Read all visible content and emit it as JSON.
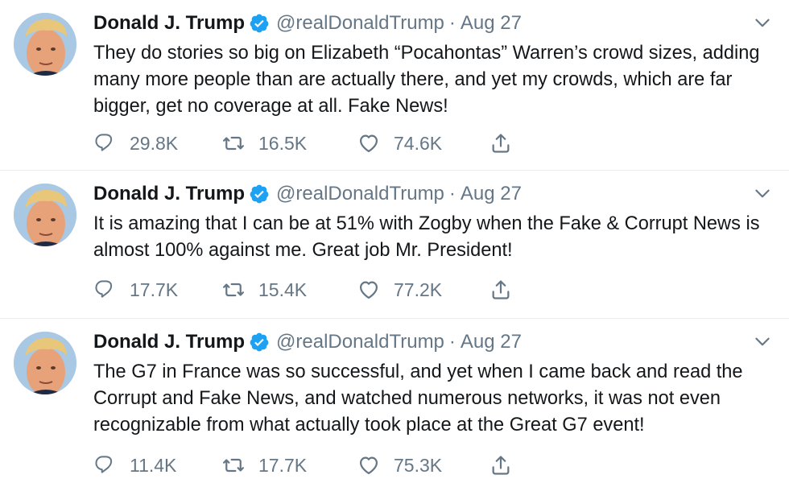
{
  "tweets": [
    {
      "author": {
        "name": "Donald J. Trump",
        "handle": "@realDonaldTrump",
        "verified": true
      },
      "separator": "·",
      "date": "Aug 27",
      "text": "They do stories so big on Elizabeth “Pocahontas” Warren’s crowd sizes, adding many more people than are actually there, and yet my crowds, which are far bigger, get no coverage at all. Fake News!",
      "replies": "29.8K",
      "retweets": "16.5K",
      "likes": "74.6K"
    },
    {
      "author": {
        "name": "Donald J. Trump",
        "handle": "@realDonaldTrump",
        "verified": true
      },
      "separator": "·",
      "date": "Aug 27",
      "text": "It is amazing that I can be at 51% with Zogby when the Fake & Corrupt News is almost 100% against me. Great job Mr. President!",
      "replies": "17.7K",
      "retweets": "15.4K",
      "likes": "77.2K"
    },
    {
      "author": {
        "name": "Donald J. Trump",
        "handle": "@realDonaldTrump",
        "verified": true
      },
      "separator": "·",
      "date": "Aug 27",
      "text": "The G7 in France was so successful, and yet when I came back and read the Corrupt and Fake News, and watched numerous networks, it was not even recognizable from what actually took place at the Great G7 event!",
      "replies": "11.4K",
      "retweets": "17.7K",
      "likes": "75.3K"
    }
  ],
  "icons": {
    "reply": "reply-icon",
    "retweet": "retweet-icon",
    "like": "heart-icon",
    "share": "share-icon",
    "verified": "verified-badge-icon",
    "caret": "chevron-down-icon"
  },
  "colors": {
    "verified_blue": "#1da1f2",
    "secondary_text": "#657786",
    "primary_text": "#14171a",
    "divider": "#e6ecf0"
  }
}
